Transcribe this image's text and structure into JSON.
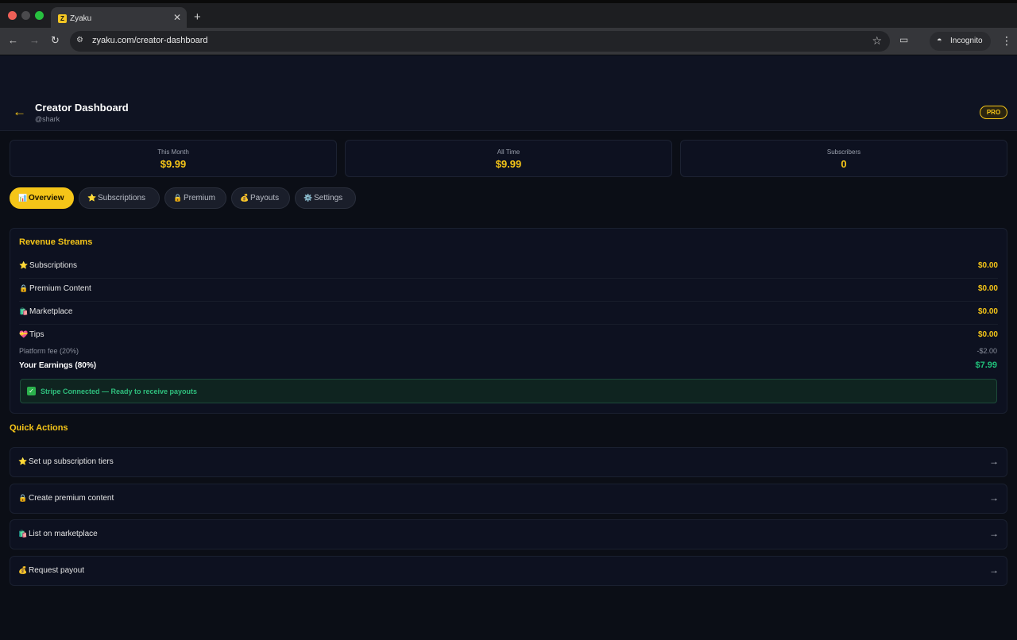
{
  "browser": {
    "tab_title": "Zyaku",
    "favicon_letter": "Z",
    "url": "zyaku.com/creator-dashboard",
    "incognito_label": "Incognito"
  },
  "header": {
    "title": "Creator Dashboard",
    "username": "@shark",
    "badge": "PRO"
  },
  "stats": [
    {
      "label": "This Month",
      "value": "$9.99"
    },
    {
      "label": "All Time",
      "value": "$9.99"
    },
    {
      "label": "Subscribers",
      "value": "0"
    }
  ],
  "tabs": [
    {
      "icon": "📊",
      "label": "Overview",
      "active": true
    },
    {
      "icon": "⭐",
      "label": "Subscriptions"
    },
    {
      "icon": "🔒",
      "label": "Premium"
    },
    {
      "icon": "💰",
      "label": "Payouts"
    },
    {
      "icon": "⚙️",
      "label": "Settings"
    }
  ],
  "revenue": {
    "title": "Revenue Streams",
    "streams": [
      {
        "icon": "⭐",
        "label": "Subscriptions",
        "value": "$0.00"
      },
      {
        "icon": "🔒",
        "label": "Premium Content",
        "value": "$0.00"
      },
      {
        "icon": "🛍️",
        "label": "Marketplace",
        "value": "$0.00"
      },
      {
        "icon": "💝",
        "label": "Tips",
        "value": "$0.00"
      }
    ],
    "fee_label": "Platform fee (20%)",
    "fee_value": "-$2.00",
    "earnings_label": "Your Earnings (80%)",
    "earnings_value": "$7.99",
    "stripe_status": "Stripe Connected — Ready to receive payouts"
  },
  "quick_actions": {
    "title": "Quick Actions",
    "items": [
      {
        "icon": "⭐",
        "label": "Set up subscription tiers"
      },
      {
        "icon": "🔒",
        "label": "Create premium content"
      },
      {
        "icon": "🛍️",
        "label": "List on marketplace"
      },
      {
        "icon": "💰",
        "label": "Request payout"
      }
    ]
  },
  "colors": {
    "accent": "#f5c518",
    "success": "#20c07a",
    "background": "#0b0e16"
  }
}
